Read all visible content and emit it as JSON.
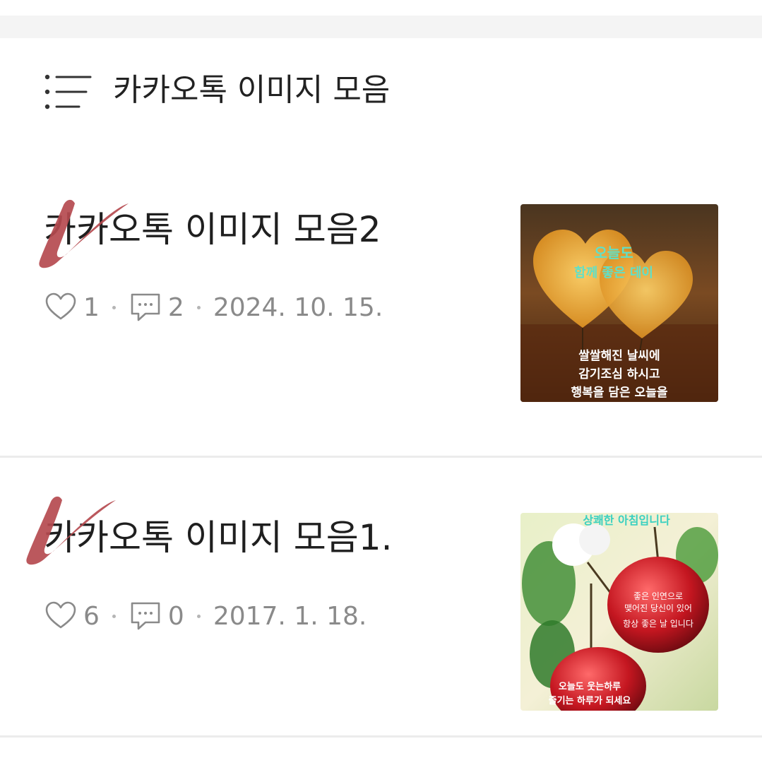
{
  "category": {
    "title": "카카오톡 이미지 모음",
    "icon": "list-icon"
  },
  "posts": [
    {
      "title": "카카오톡 이미지 모음2",
      "likes": "1",
      "comments": "2",
      "date": "2024. 10. 15.",
      "thumbnail": {
        "icon": "hearts-image",
        "texts": [
          "오늘도",
          "함께 좋은 데이",
          "쌀쌀해진 날씨에",
          "감기조심 하시고",
          "행복을 담은 오늘을"
        ]
      }
    },
    {
      "title": "카카오톡 이미지 모음1.",
      "likes": "6",
      "comments": "0",
      "date": "2017. 1. 18.",
      "thumbnail": {
        "icon": "cherries-image",
        "texts": [
          "상쾌한 아침입니다",
          "좋은 인연으로",
          "맺어진 당신이 있어",
          "항상  좋은 날 입니다",
          "오늘도 웃는하루",
          "즐기는 하루가 되세요"
        ]
      }
    }
  ],
  "colors": {
    "checkmark": "#b54a4f",
    "meta_text": "#8a8a8a",
    "divider": "#ececec",
    "band": "#f4f4f4"
  }
}
